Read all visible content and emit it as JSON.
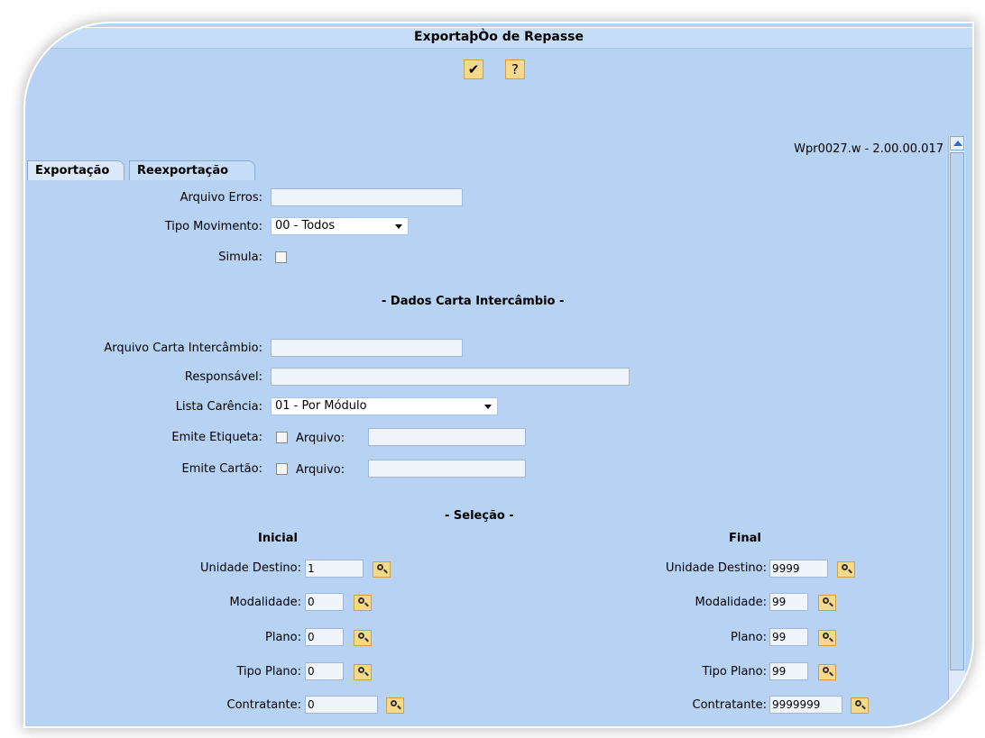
{
  "window": {
    "title": "ExportaþÒo de Repasse",
    "version": "Wpr0027.w - 2.00.00.017"
  },
  "toolbar": {
    "confirm_glyph": "✔",
    "help_glyph": "?"
  },
  "tabs": [
    {
      "label": "Exportação"
    },
    {
      "label": "Reexportação"
    }
  ],
  "form": {
    "arquivo_erros": {
      "label": "Arquivo Erros:",
      "value": ""
    },
    "tipo_movimento": {
      "label": "Tipo Movimento:",
      "value": "00 - Todos"
    },
    "simula": {
      "label": "Simula:"
    },
    "dados_carta_heading": "- Dados Carta Intercâmbio -",
    "arquivo_carta": {
      "label": "Arquivo Carta Intercâmbio:",
      "value": ""
    },
    "responsavel": {
      "label": "Responsável:",
      "value": ""
    },
    "lista_carencia": {
      "label": "Lista Carência:",
      "value": "01 - Por Módulo"
    },
    "emite_etiqueta": {
      "label": "Emite Etiqueta:",
      "arquivo_label": "Arquivo:",
      "value": ""
    },
    "emite_cartao": {
      "label": "Emite Cartão:",
      "arquivo_label": "Arquivo:",
      "value": ""
    },
    "selecao_heading": "- Seleção -",
    "inicial": {
      "heading": "Inicial",
      "unidade_destino": {
        "label": "Unidade Destino:",
        "value": "1"
      },
      "modalidade": {
        "label": "Modalidade:",
        "value": "0"
      },
      "plano": {
        "label": "Plano:",
        "value": "0"
      },
      "tipo_plano": {
        "label": "Tipo Plano:",
        "value": "0"
      },
      "contratante": {
        "label": "Contratante:",
        "value": "0"
      }
    },
    "final": {
      "heading": "Final",
      "unidade_destino": {
        "label": "Unidade Destino:",
        "value": "9999"
      },
      "modalidade": {
        "label": "Modalidade:",
        "value": "99"
      },
      "plano": {
        "label": "Plano:",
        "value": "99"
      },
      "tipo_plano": {
        "label": "Tipo Plano:",
        "value": "99"
      },
      "contratante": {
        "label": "Contratante:",
        "value": "9999999"
      }
    }
  }
}
